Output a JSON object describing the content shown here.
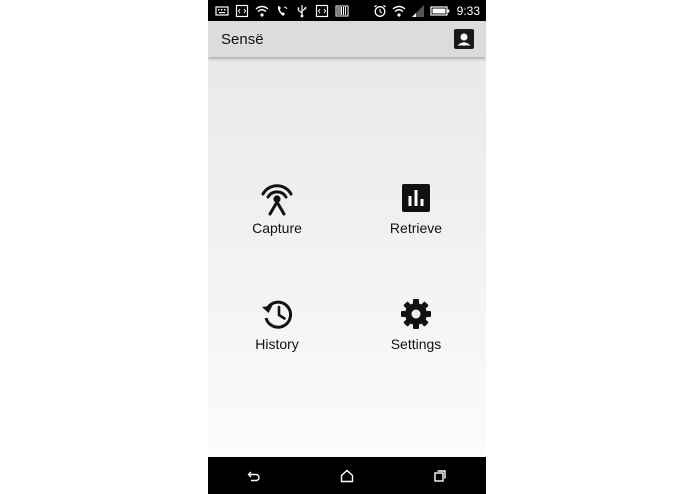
{
  "status_bar": {
    "time": "9:33",
    "icons_left": [
      "keyboard-icon",
      "code-icon",
      "wifi-icon",
      "wifi-call-icon",
      "usb-icon",
      "code-icon",
      "barcode-icon"
    ],
    "icons_right": [
      "alarm-icon",
      "wifi-icon",
      "signal-icon",
      "battery-icon"
    ]
  },
  "app_bar": {
    "title": "Sensë",
    "profile_icon": "account-box-icon"
  },
  "tiles": [
    {
      "label": "Capture",
      "icon": "broadcast-icon"
    },
    {
      "label": "Retrieve",
      "icon": "bar-chart-icon"
    },
    {
      "label": "History",
      "icon": "history-icon"
    },
    {
      "label": "Settings",
      "icon": "gear-icon"
    }
  ],
  "nav_bar": {
    "buttons": [
      "back-icon",
      "home-icon",
      "recents-icon"
    ]
  }
}
